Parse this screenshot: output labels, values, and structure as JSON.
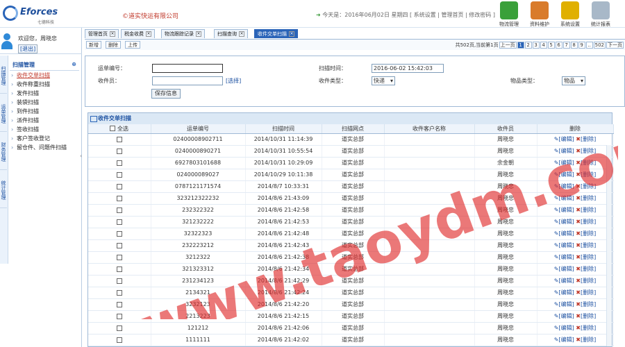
{
  "header": {
    "brand": "Eforces",
    "brand_sub": "七德科技",
    "company": "©道实快运有限公司",
    "date_info": "今天是：2016年06月02日 星期四 [ 系统设置 | 管理首页 | 修改密码 ]",
    "tools": [
      {
        "label": "物流管理",
        "icon": "logistics-icon",
        "color": "#3aa03a"
      },
      {
        "label": "资料维护",
        "icon": "data-maintain-icon",
        "color": "#d97b2b"
      },
      {
        "label": "系统设置",
        "icon": "settings-icon",
        "color": "#e0b000"
      },
      {
        "label": "统计报表",
        "icon": "stats-icon",
        "color": "#a8b8c8"
      }
    ]
  },
  "sidebar": {
    "welcome": "欢迎您，周晓忠",
    "logout": "[退出]",
    "side_tabs": [
      "扫描管理",
      "运单管理",
      "财务管理",
      "统计管理"
    ],
    "menu_title": "扫描管理",
    "menu_items": [
      "收件交单扫描",
      "收件称重扫描",
      "发件扫描",
      "装袋扫描",
      "到件扫描",
      "派件扫描",
      "签收扫描",
      "客户签收登记",
      "留仓件、问题件扫描"
    ],
    "active_index": 0
  },
  "tabs": [
    {
      "label": "管理首页"
    },
    {
      "label": "税金收费"
    },
    {
      "label": "物流跟踪记录"
    },
    {
      "label": "扫描查询"
    },
    {
      "label": "收件交单扫描",
      "active": true
    }
  ],
  "toolbar": {
    "buttons": [
      "新增",
      "删除",
      "上传"
    ],
    "summary": "共502页,当前第1页",
    "pages": [
      "1",
      "2",
      "3",
      "4",
      "5",
      "6",
      "7",
      "8",
      "9",
      "..",
      "502"
    ],
    "prev": "上一页",
    "next": "下一页"
  },
  "form": {
    "waybill_label": "运单编号：",
    "waybill_value": "",
    "scan_time_label": "扫描时间：",
    "scan_time_value": "2016-06-02 15:42:03",
    "receiver_label": "收件员：",
    "receiver_value": "",
    "select_link": "[选择]",
    "type_label": "收件类型：",
    "type_value": "快递",
    "goods_label": "物品类型：",
    "goods_value": "物品",
    "save": "保存信息"
  },
  "grid": {
    "title": "收件交单扫描",
    "columns": [
      "全选",
      "运单编号",
      "扫描时间",
      "扫描网点",
      "收件客户名称",
      "收件员",
      "删除"
    ],
    "rows": [
      [
        "02400008902711",
        "2014/10/31 11:14:39",
        "道实总部",
        "",
        "周晓忠"
      ],
      [
        "0240000890271",
        "2014/10/31 10:55:54",
        "道实总部",
        "",
        "周晓忠"
      ],
      [
        "6927803101688",
        "2014/10/31 10:29:09",
        "道实总部",
        "",
        "余金朝"
      ],
      [
        "024000089027",
        "2014/10/29 10:11:38",
        "道实总部",
        "",
        "周晓忠"
      ],
      [
        "0787121171574",
        "2014/8/7 10:33:31",
        "道实总部",
        "",
        "周晓忠"
      ],
      [
        "323212322232",
        "2014/8/6 21:43:09",
        "道实总部",
        "",
        "周晓忠"
      ],
      [
        "232322322",
        "2014/8/6 21:42:58",
        "道实总部",
        "",
        "周晓忠"
      ],
      [
        "321232222",
        "2014/8/6 21:42:53",
        "道实总部",
        "",
        "周晓忠"
      ],
      [
        "32322323",
        "2014/8/6 21:42:48",
        "道实总部",
        "",
        "周晓忠"
      ],
      [
        "232223212",
        "2014/8/6 21:42:43",
        "道实总部",
        "",
        "周晓忠"
      ],
      [
        "3212322",
        "2014/8/6 21:42:38",
        "道实总部",
        "",
        "周晓忠"
      ],
      [
        "321323312",
        "2014/8/6 21:42:34",
        "道实总部",
        "",
        "周晓忠"
      ],
      [
        "231234123",
        "2014/8/6 21:42:29",
        "道实总部",
        "",
        "周晓忠"
      ],
      [
        "2134321",
        "2014/8/6 21:42:24",
        "道实总部",
        "",
        "周晓忠"
      ],
      [
        "3232123",
        "2014/8/6 21:42:20",
        "道实总部",
        "",
        "周晓忠"
      ],
      [
        "2213223",
        "2014/8/6 21:42:15",
        "道实总部",
        "",
        "周晓忠"
      ],
      [
        "121212",
        "2014/8/6 21:42:06",
        "道实总部",
        "",
        "周晓忠"
      ],
      [
        "1111111",
        "2014/8/6 21:42:02",
        "道实总部",
        "",
        "周晓忠"
      ]
    ],
    "edit_label": "[编辑]",
    "delete_label": "[删除]"
  },
  "watermark": "www.taoydm.com"
}
